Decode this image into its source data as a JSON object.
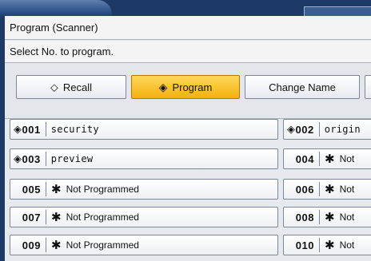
{
  "window": {
    "title": "Program (Scanner)"
  },
  "instruction": "Select No. to program.",
  "modes": {
    "recall": {
      "label": "Recall",
      "icon": "recall-icon"
    },
    "program": {
      "label": "Program",
      "icon": "program-icon",
      "active": true
    },
    "change_name": {
      "label": "Change Name"
    }
  },
  "colors": {
    "active_button": "#f4b10e",
    "frame": "#1d3a66"
  },
  "programs": [
    {
      "no": "001",
      "name": "security",
      "registered": true
    },
    {
      "no": "002",
      "name": "origin",
      "registered": true
    },
    {
      "no": "003",
      "name": "preview",
      "registered": true
    },
    {
      "no": "004",
      "name": "Not",
      "registered": false
    },
    {
      "no": "005",
      "name": "Not Programmed",
      "registered": false
    },
    {
      "no": "006",
      "name": "Not",
      "registered": false
    },
    {
      "no": "007",
      "name": "Not Programmed",
      "registered": false
    },
    {
      "no": "008",
      "name": "Not",
      "registered": false
    },
    {
      "no": "009",
      "name": "Not Programmed",
      "registered": false
    },
    {
      "no": "010",
      "name": "Not",
      "registered": false
    }
  ],
  "unprogrammed_mark": "✱"
}
